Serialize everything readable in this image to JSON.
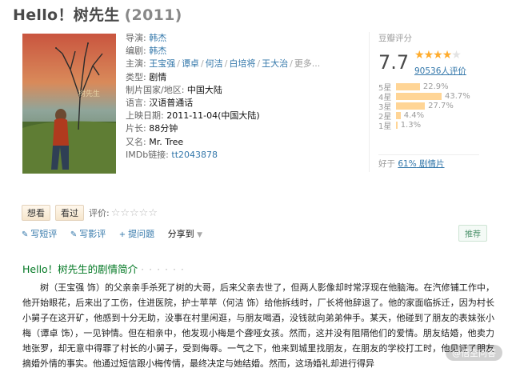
{
  "title": {
    "name": "Hello！树先生",
    "year": "(2011)"
  },
  "poster": {
    "alt": "poster-image"
  },
  "info": {
    "director_label": "导演:",
    "director": "韩杰",
    "writer_label": "编剧:",
    "writer": "韩杰",
    "cast_label": "主演:",
    "cast": [
      "王宝强",
      "谭卓",
      "何洁",
      "白培将",
      "王大治",
      "更多..."
    ],
    "genre_label": "类型:",
    "genre": "剧情",
    "country_label": "制片国家/地区:",
    "country": "中国大陆",
    "language_label": "语言:",
    "language": "汉语普通话",
    "release_label": "上映日期:",
    "release": "2011-11-04(中国大陆)",
    "runtime_label": "片长:",
    "runtime": "88分钟",
    "aka_label": "又名:",
    "aka": "Mr. Tree",
    "imdb_label": "IMDb链接:",
    "imdb": "tt2043878"
  },
  "rating": {
    "label": "豆瓣评分",
    "score": "7.7",
    "star_level": 4,
    "votes": "90536人评价",
    "distribution": [
      {
        "label": "5星",
        "pct": "22.9%",
        "value": 22.9
      },
      {
        "label": "4星",
        "pct": "43.7%",
        "value": 43.7
      },
      {
        "label": "3星",
        "pct": "27.7%",
        "value": 27.7
      },
      {
        "label": "2星",
        "pct": "4.4%",
        "value": 4.4
      },
      {
        "label": "1星",
        "pct": "1.3%",
        "value": 1.3
      }
    ],
    "better_prefix": "好于",
    "better_pct": "61%",
    "better_suffix": "剧情片"
  },
  "actions": {
    "want": "想看",
    "seen": "看过",
    "rate_label": "评价:"
  },
  "share": {
    "review": "写短评",
    "long_review": "写影评",
    "question": "提问题",
    "share": "分享到"
  },
  "recommend": "推荐",
  "section": {
    "title": "Hello！树先生的剧情简介",
    "dots": "· · · · · ·"
  },
  "synopsis": "树（王宝强 饰）的父亲亲手杀死了树的大哥，后来父亲去世了，但两人影像却时常浮现在他脑海。在汽修铺工作中，他开始眼花，后来出了工伤，住进医院，护士苹苹（何洁 饰）给他拆线时，厂长将他辞退了。他的家面临拆迁，因为村长小舅子在这开矿，他感到十分无助，没事在村里闲逛，与朋友喝酒，没钱就向弟弟伸手。某天，他碰到了朋友的表妹张小梅（谭卓 饰），一见钟情。但在相亲中，他发现小梅是个聋哑女孩。然而，这并没有阻隔他们的爱情。朋友结婚，他卖力地张罗，却无意中得罪了村长的小舅子，受到侮辱。一气之下，他来到城里找朋友，在朋友的学校打工时，他见证了朋友摘婚外情的事实。他通过短信跟小梅传情，最终决定与她结婚。然而，这场婚礼却进行得异",
  "watermark": "@悟空问答"
}
